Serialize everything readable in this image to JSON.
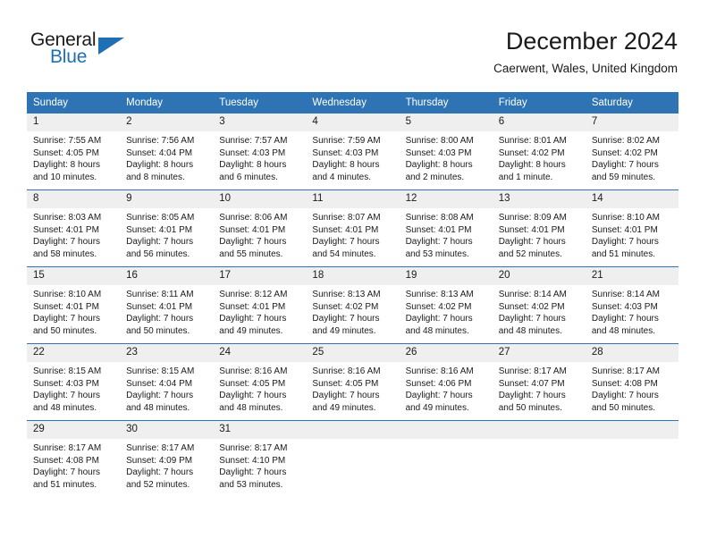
{
  "logo": {
    "word_top": "General",
    "word_bottom": "Blue",
    "icon": "triangle-icon",
    "accent_color": "#1f6fb5"
  },
  "header": {
    "month_title": "December 2024",
    "location": "Caerwent, Wales, United Kingdom"
  },
  "colors": {
    "header_blue": "#2e74b5",
    "daynum_band": "#efefef",
    "text": "#1a1a1a"
  },
  "calendar": {
    "weekday_headers": [
      "Sunday",
      "Monday",
      "Tuesday",
      "Wednesday",
      "Thursday",
      "Friday",
      "Saturday"
    ],
    "weeks": [
      [
        {
          "day": "1",
          "sunrise": "Sunrise: 7:55 AM",
          "sunset": "Sunset: 4:05 PM",
          "daylight_line1": "Daylight: 8 hours",
          "daylight_line2": "and 10 minutes."
        },
        {
          "day": "2",
          "sunrise": "Sunrise: 7:56 AM",
          "sunset": "Sunset: 4:04 PM",
          "daylight_line1": "Daylight: 8 hours",
          "daylight_line2": "and 8 minutes."
        },
        {
          "day": "3",
          "sunrise": "Sunrise: 7:57 AM",
          "sunset": "Sunset: 4:03 PM",
          "daylight_line1": "Daylight: 8 hours",
          "daylight_line2": "and 6 minutes."
        },
        {
          "day": "4",
          "sunrise": "Sunrise: 7:59 AM",
          "sunset": "Sunset: 4:03 PM",
          "daylight_line1": "Daylight: 8 hours",
          "daylight_line2": "and 4 minutes."
        },
        {
          "day": "5",
          "sunrise": "Sunrise: 8:00 AM",
          "sunset": "Sunset: 4:03 PM",
          "daylight_line1": "Daylight: 8 hours",
          "daylight_line2": "and 2 minutes."
        },
        {
          "day": "6",
          "sunrise": "Sunrise: 8:01 AM",
          "sunset": "Sunset: 4:02 PM",
          "daylight_line1": "Daylight: 8 hours",
          "daylight_line2": "and 1 minute."
        },
        {
          "day": "7",
          "sunrise": "Sunrise: 8:02 AM",
          "sunset": "Sunset: 4:02 PM",
          "daylight_line1": "Daylight: 7 hours",
          "daylight_line2": "and 59 minutes."
        }
      ],
      [
        {
          "day": "8",
          "sunrise": "Sunrise: 8:03 AM",
          "sunset": "Sunset: 4:01 PM",
          "daylight_line1": "Daylight: 7 hours",
          "daylight_line2": "and 58 minutes."
        },
        {
          "day": "9",
          "sunrise": "Sunrise: 8:05 AM",
          "sunset": "Sunset: 4:01 PM",
          "daylight_line1": "Daylight: 7 hours",
          "daylight_line2": "and 56 minutes."
        },
        {
          "day": "10",
          "sunrise": "Sunrise: 8:06 AM",
          "sunset": "Sunset: 4:01 PM",
          "daylight_line1": "Daylight: 7 hours",
          "daylight_line2": "and 55 minutes."
        },
        {
          "day": "11",
          "sunrise": "Sunrise: 8:07 AM",
          "sunset": "Sunset: 4:01 PM",
          "daylight_line1": "Daylight: 7 hours",
          "daylight_line2": "and 54 minutes."
        },
        {
          "day": "12",
          "sunrise": "Sunrise: 8:08 AM",
          "sunset": "Sunset: 4:01 PM",
          "daylight_line1": "Daylight: 7 hours",
          "daylight_line2": "and 53 minutes."
        },
        {
          "day": "13",
          "sunrise": "Sunrise: 8:09 AM",
          "sunset": "Sunset: 4:01 PM",
          "daylight_line1": "Daylight: 7 hours",
          "daylight_line2": "and 52 minutes."
        },
        {
          "day": "14",
          "sunrise": "Sunrise: 8:10 AM",
          "sunset": "Sunset: 4:01 PM",
          "daylight_line1": "Daylight: 7 hours",
          "daylight_line2": "and 51 minutes."
        }
      ],
      [
        {
          "day": "15",
          "sunrise": "Sunrise: 8:10 AM",
          "sunset": "Sunset: 4:01 PM",
          "daylight_line1": "Daylight: 7 hours",
          "daylight_line2": "and 50 minutes."
        },
        {
          "day": "16",
          "sunrise": "Sunrise: 8:11 AM",
          "sunset": "Sunset: 4:01 PM",
          "daylight_line1": "Daylight: 7 hours",
          "daylight_line2": "and 50 minutes."
        },
        {
          "day": "17",
          "sunrise": "Sunrise: 8:12 AM",
          "sunset": "Sunset: 4:01 PM",
          "daylight_line1": "Daylight: 7 hours",
          "daylight_line2": "and 49 minutes."
        },
        {
          "day": "18",
          "sunrise": "Sunrise: 8:13 AM",
          "sunset": "Sunset: 4:02 PM",
          "daylight_line1": "Daylight: 7 hours",
          "daylight_line2": "and 49 minutes."
        },
        {
          "day": "19",
          "sunrise": "Sunrise: 8:13 AM",
          "sunset": "Sunset: 4:02 PM",
          "daylight_line1": "Daylight: 7 hours",
          "daylight_line2": "and 48 minutes."
        },
        {
          "day": "20",
          "sunrise": "Sunrise: 8:14 AM",
          "sunset": "Sunset: 4:02 PM",
          "daylight_line1": "Daylight: 7 hours",
          "daylight_line2": "and 48 minutes."
        },
        {
          "day": "21",
          "sunrise": "Sunrise: 8:14 AM",
          "sunset": "Sunset: 4:03 PM",
          "daylight_line1": "Daylight: 7 hours",
          "daylight_line2": "and 48 minutes."
        }
      ],
      [
        {
          "day": "22",
          "sunrise": "Sunrise: 8:15 AM",
          "sunset": "Sunset: 4:03 PM",
          "daylight_line1": "Daylight: 7 hours",
          "daylight_line2": "and 48 minutes."
        },
        {
          "day": "23",
          "sunrise": "Sunrise: 8:15 AM",
          "sunset": "Sunset: 4:04 PM",
          "daylight_line1": "Daylight: 7 hours",
          "daylight_line2": "and 48 minutes."
        },
        {
          "day": "24",
          "sunrise": "Sunrise: 8:16 AM",
          "sunset": "Sunset: 4:05 PM",
          "daylight_line1": "Daylight: 7 hours",
          "daylight_line2": "and 48 minutes."
        },
        {
          "day": "25",
          "sunrise": "Sunrise: 8:16 AM",
          "sunset": "Sunset: 4:05 PM",
          "daylight_line1": "Daylight: 7 hours",
          "daylight_line2": "and 49 minutes."
        },
        {
          "day": "26",
          "sunrise": "Sunrise: 8:16 AM",
          "sunset": "Sunset: 4:06 PM",
          "daylight_line1": "Daylight: 7 hours",
          "daylight_line2": "and 49 minutes."
        },
        {
          "day": "27",
          "sunrise": "Sunrise: 8:17 AM",
          "sunset": "Sunset: 4:07 PM",
          "daylight_line1": "Daylight: 7 hours",
          "daylight_line2": "and 50 minutes."
        },
        {
          "day": "28",
          "sunrise": "Sunrise: 8:17 AM",
          "sunset": "Sunset: 4:08 PM",
          "daylight_line1": "Daylight: 7 hours",
          "daylight_line2": "and 50 minutes."
        }
      ],
      [
        {
          "day": "29",
          "sunrise": "Sunrise: 8:17 AM",
          "sunset": "Sunset: 4:08 PM",
          "daylight_line1": "Daylight: 7 hours",
          "daylight_line2": "and 51 minutes."
        },
        {
          "day": "30",
          "sunrise": "Sunrise: 8:17 AM",
          "sunset": "Sunset: 4:09 PM",
          "daylight_line1": "Daylight: 7 hours",
          "daylight_line2": "and 52 minutes."
        },
        {
          "day": "31",
          "sunrise": "Sunrise: 8:17 AM",
          "sunset": "Sunset: 4:10 PM",
          "daylight_line1": "Daylight: 7 hours",
          "daylight_line2": "and 53 minutes."
        },
        {
          "day": "",
          "sunrise": "",
          "sunset": "",
          "daylight_line1": "",
          "daylight_line2": ""
        },
        {
          "day": "",
          "sunrise": "",
          "sunset": "",
          "daylight_line1": "",
          "daylight_line2": ""
        },
        {
          "day": "",
          "sunrise": "",
          "sunset": "",
          "daylight_line1": "",
          "daylight_line2": ""
        },
        {
          "day": "",
          "sunrise": "",
          "sunset": "",
          "daylight_line1": "",
          "daylight_line2": ""
        }
      ]
    ]
  }
}
